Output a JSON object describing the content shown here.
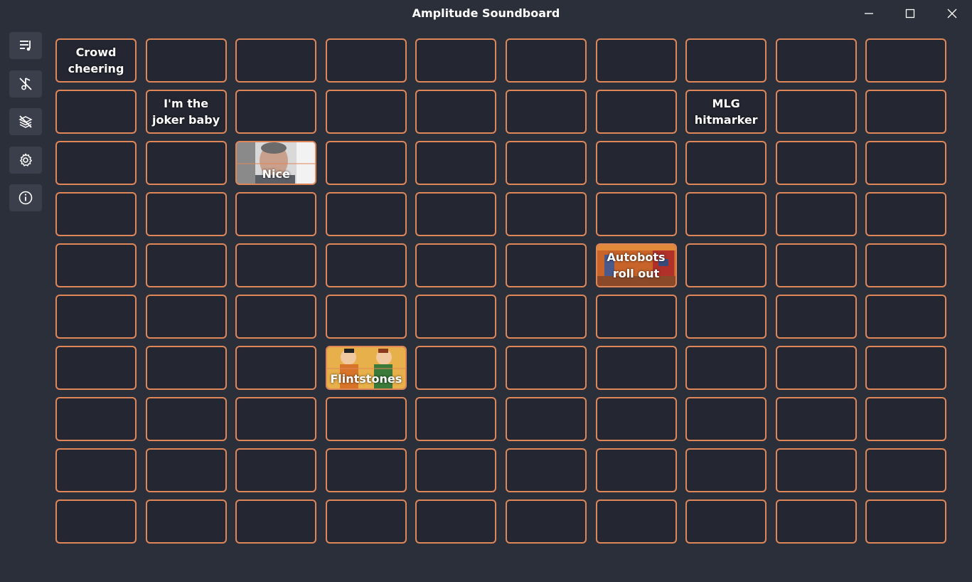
{
  "window": {
    "title": "Amplitude Soundboard",
    "controls": [
      "minimize",
      "maximize",
      "close"
    ]
  },
  "sidebar": {
    "buttons": [
      {
        "icon": "queue-list-icon",
        "name": "queue-button"
      },
      {
        "icon": "stop-music-icon",
        "name": "stop-sound-button"
      },
      {
        "icon": "hide-layers-icon",
        "name": "toggle-layers-button"
      },
      {
        "icon": "gear-icon",
        "name": "settings-button"
      },
      {
        "icon": "info-icon",
        "name": "about-button"
      }
    ]
  },
  "grid": {
    "rows": 10,
    "columns": 10,
    "accent_color": "#e0875a",
    "pads": [
      {
        "row": 0,
        "col": 0,
        "label": "Crowd cheering",
        "image": null
      },
      {
        "row": 1,
        "col": 1,
        "label": "I'm the joker baby",
        "image": null
      },
      {
        "row": 1,
        "col": 7,
        "label": "MLG hitmarker",
        "image": null
      },
      {
        "row": 2,
        "col": 2,
        "label": "Nice",
        "image": "man-photo"
      },
      {
        "row": 4,
        "col": 6,
        "label": "Autobots roll out",
        "image": "robot-art"
      },
      {
        "row": 6,
        "col": 3,
        "label": "Flintstones",
        "image": "cartoon-art"
      }
    ]
  }
}
